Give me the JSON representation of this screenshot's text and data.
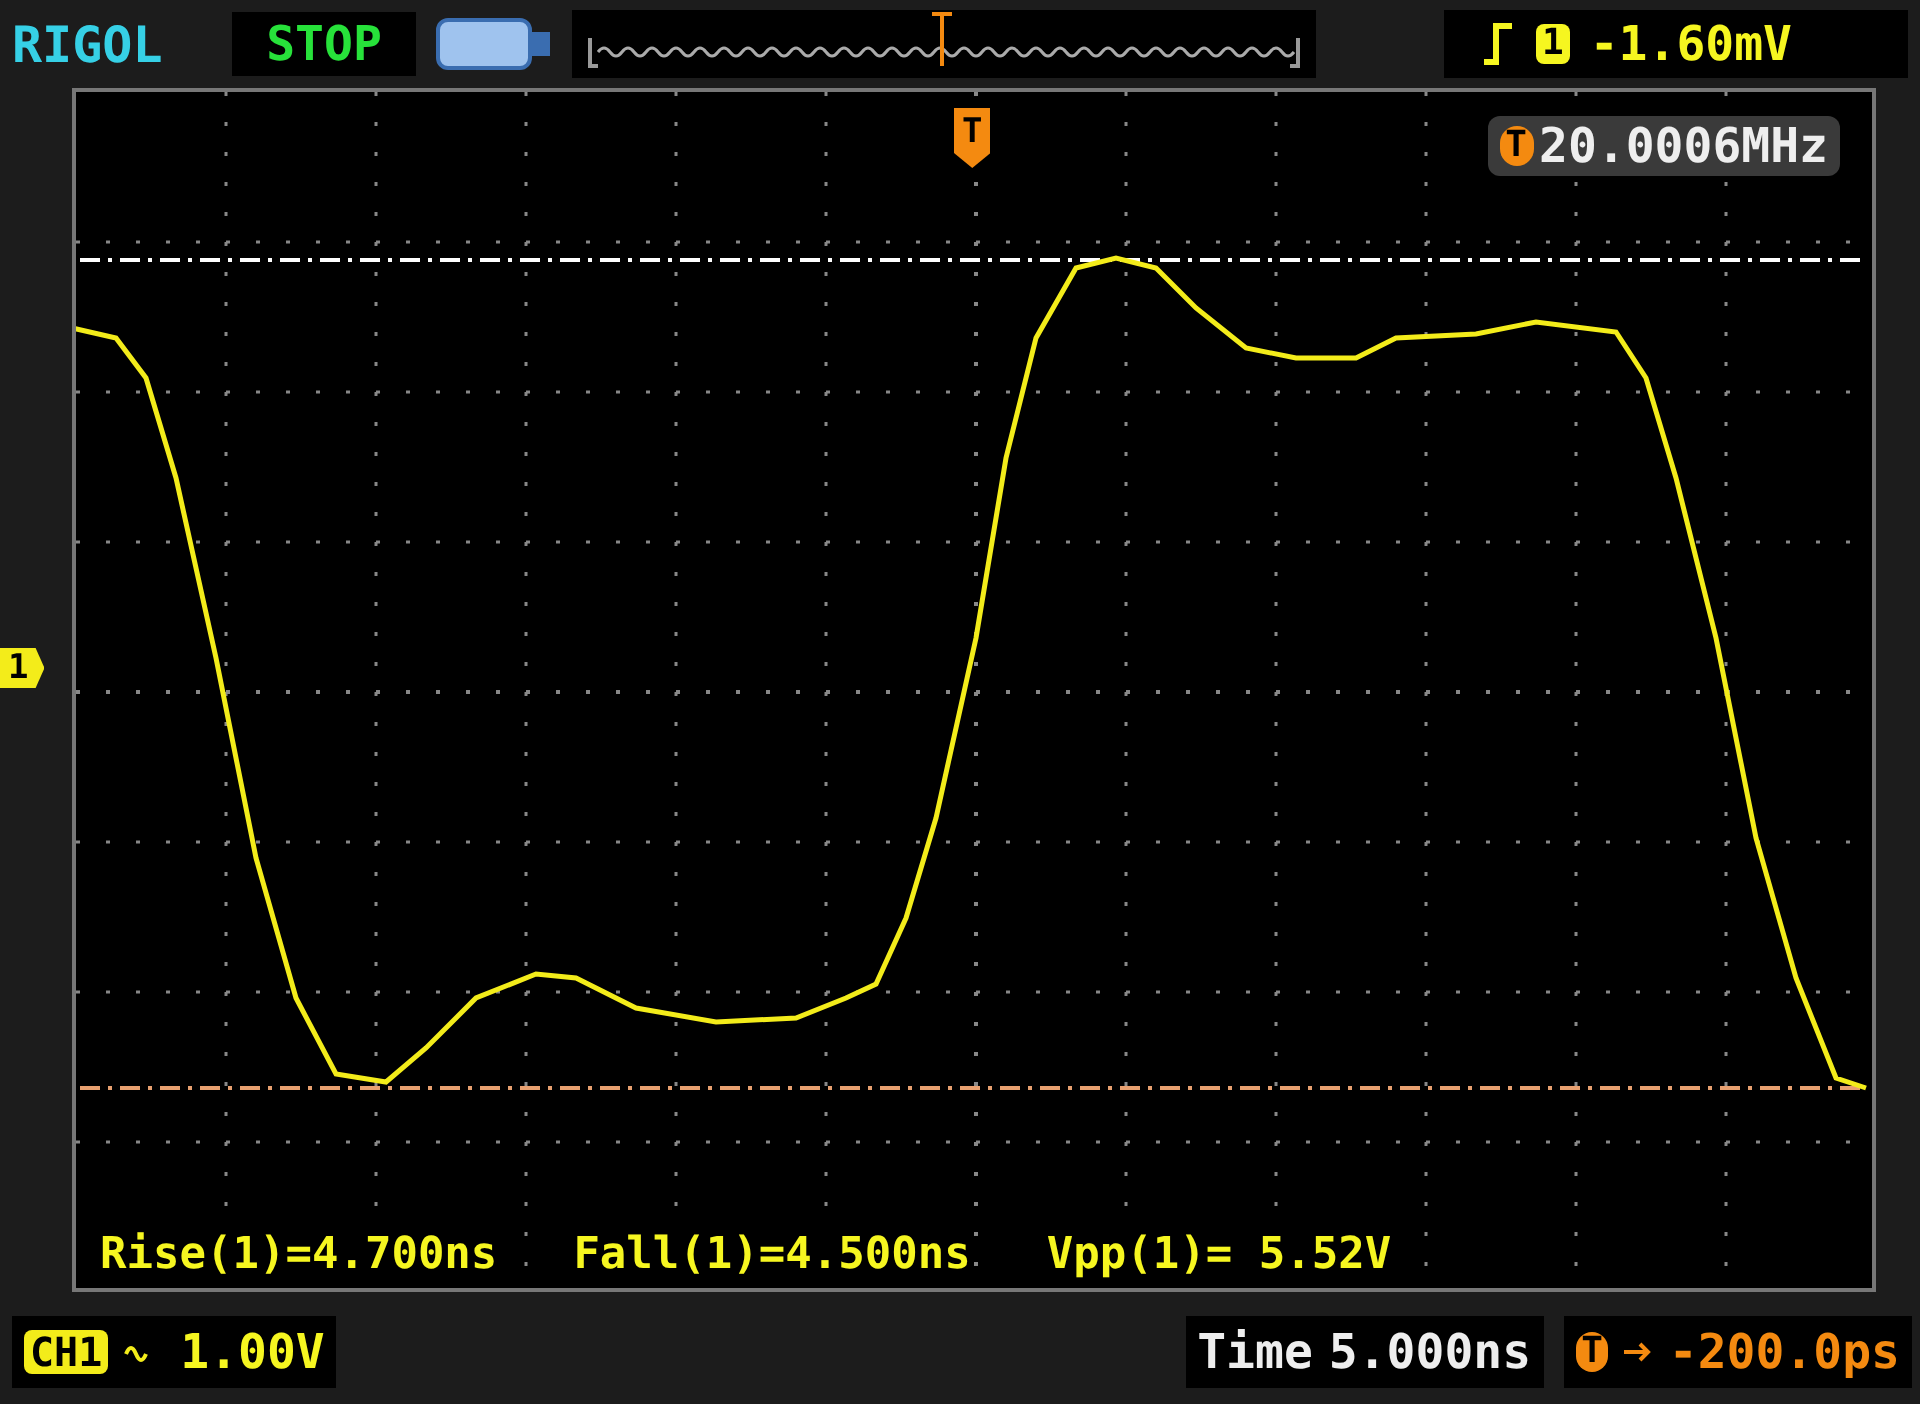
{
  "header": {
    "brand": "RIGOL",
    "status": "STOP",
    "trigger": {
      "source_badge": "1",
      "level": "-1.60mV"
    }
  },
  "screen": {
    "trigger_marker": "T",
    "channel_marker": "1",
    "frequency": {
      "badge": "T",
      "value": "20.0006MHz"
    },
    "measurements": [
      "Rise(1)=4.700ns",
      "Fall(1)=4.500ns",
      "Vpp(1)= 5.52V"
    ]
  },
  "footer": {
    "channel": "CH1",
    "scale": "1.00V",
    "time_label": "Time",
    "time_scale": "5.000ns",
    "offset_badge": "T",
    "offset": "-200.0ps"
  }
}
